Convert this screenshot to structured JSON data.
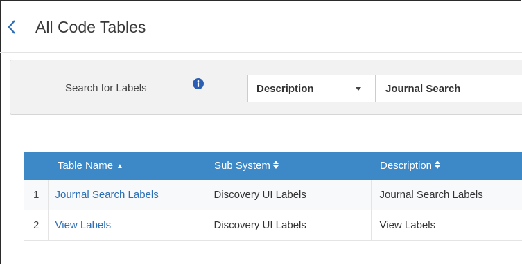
{
  "header": {
    "title": "All Code Tables",
    "back_icon": "chevron-left-icon"
  },
  "search": {
    "label": "Search for Labels",
    "info_icon": "info-icon",
    "field_selected": "Description",
    "query": "Journal Search"
  },
  "table": {
    "columns": [
      {
        "label": "Table Name",
        "sort": "ascending"
      },
      {
        "label": "Sub System",
        "sort": "sortable"
      },
      {
        "label": "Description",
        "sort": "sortable"
      }
    ],
    "rows": [
      {
        "index": "1",
        "table_name": "Journal Search Labels",
        "sub_system": "Discovery UI Labels",
        "description": "Journal Search Labels"
      },
      {
        "index": "2",
        "table_name": "View Labels",
        "sub_system": "Discovery UI Labels",
        "description": "View Labels"
      }
    ]
  },
  "colors": {
    "header_bar": "#3d88c6",
    "link": "#2d6fb5",
    "info_icon": "#2b5fb3"
  }
}
